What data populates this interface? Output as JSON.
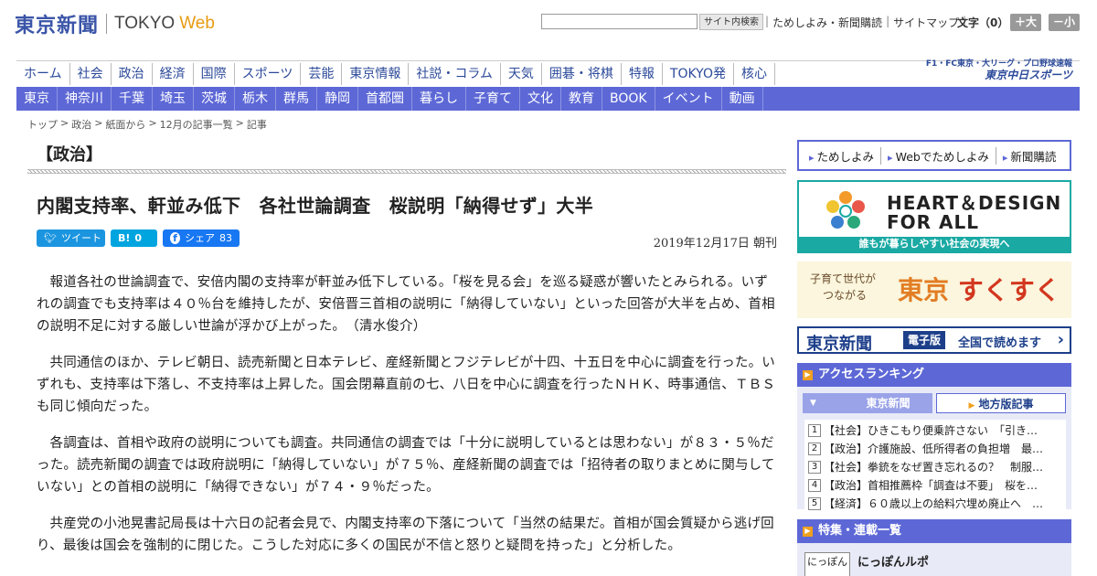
{
  "header": {
    "logo_jp": "東京新聞",
    "logo_en": "TOKYO",
    "logo_web": "Web",
    "search_button": "サイト内検索",
    "util_links": [
      "ためしよみ・新聞購読",
      "サイトマップ"
    ],
    "font_size_label": "文字（0）",
    "font_plus": "＋大",
    "font_minus": "－小"
  },
  "nav_top": [
    "ホーム",
    "社会",
    "政治",
    "経済",
    "国際",
    "スポーツ",
    "芸能",
    "東京情報",
    "社説・コラム",
    "天気",
    "囲碁・将棋",
    "特報",
    "TOKYO発",
    "核心"
  ],
  "chunichi": {
    "line1": "F1・FC東京・大リーグ・プロ野球速報",
    "brand": "東京中日スポーツ"
  },
  "nav_bottom": [
    "東京",
    "神奈川",
    "千葉",
    "埼玉",
    "茨城",
    "栃木",
    "群馬",
    "静岡",
    "首都圏",
    "暮らし",
    "子育て",
    "文化",
    "教育",
    "BOOK",
    "イベント",
    "動画"
  ],
  "breadcrumb": [
    "トップ",
    "政治",
    "紙面から",
    "12月の記事一覧",
    "記事"
  ],
  "section_title": "【政治】",
  "article": {
    "headline": "内閣支持率、軒並み低下　各社世論調査　桜説明「納得せず」大半",
    "share": {
      "tweet": "ツイート",
      "hatena": "B!",
      "hatena_count": "0",
      "facebook": "シェア",
      "facebook_count": "83"
    },
    "date": "2019年12月17日 朝刊",
    "paragraphs": [
      "報道各社の世論調査で、安倍内閣の支持率が軒並み低下している。「桜を見る会」を巡る疑惑が響いたとみられる。いずれの調査でも支持率は４０％台を維持したが、安倍晋三首相の説明に「納得していない」といった回答が大半を占め、首相の説明不足に対する厳しい世論が浮かび上がった。　（清水俊介）",
      "共同通信のほか、テレビ朝日、読売新聞と日本テレビ、産経新聞とフジテレビが十四、十五日を中心に調査を行った。いずれも、支持率は下落し、不支持率は上昇した。国会閉幕直前の七、八日を中心に調査を行ったＮＨＫ、時事通信、ＴＢＳも同じ傾向だった。",
      "各調査は、首相や政府の説明についても調査。共同通信の調査では「十分に説明しているとは思わない」が８３・５％だった。読売新聞の調査では政府説明に「納得していない」が７５％、産経新聞の調査では「招待者の取りまとめに関与していない」との首相の説明に「納得できない」が７４・９％だった。",
      "共産党の小池晃書記局長は十六日の記者会見で、内閣支持率の下落について「当然の結果だ。首相が国会質疑から逃げ回り、最後は国会を強制的に閉じた。こうした対応に多くの国民が不信と怒りと疑問を持った」と分析した。"
    ]
  },
  "sidebar": {
    "links": [
      "ためしよみ",
      "Webでためしよみ",
      "新聞購読"
    ],
    "hd_banner": {
      "line1": "HEART＆DESIGN",
      "line2": "FOR ALL",
      "bar": "誰もが暮らしやすい社会の実現へ"
    },
    "ss_banner": {
      "sub1": "子育て世代が",
      "sub2": "つながる",
      "main_a": "東京",
      "main_b": "すくすく"
    },
    "ep_banner": {
      "a": "東京新聞",
      "b": "電子版",
      "c": "全国で読めます"
    },
    "ranking": {
      "title": "アクセスランキング",
      "tab_on": "東京新聞",
      "tab_off": "地方版記事",
      "items": [
        {
          "n": "1",
          "t": "【社会】ひきこもり便乗許さない　「引き…"
        },
        {
          "n": "2",
          "t": "【政治】介護施設、低所得者の負担増　最…"
        },
        {
          "n": "3",
          "t": "【社会】拳銃をなぜ置き忘れるの？　制服…"
        },
        {
          "n": "4",
          "t": "【政治】首相推薦枠「調査は不要」　桜を…"
        },
        {
          "n": "5",
          "t": "【経済】６０歳以上の給料穴埋め廃止へ　…"
        }
      ]
    },
    "feature": {
      "title": "特集・連載一覧",
      "thumb": "にっぽん",
      "item": "にっぽんルポ"
    }
  }
}
